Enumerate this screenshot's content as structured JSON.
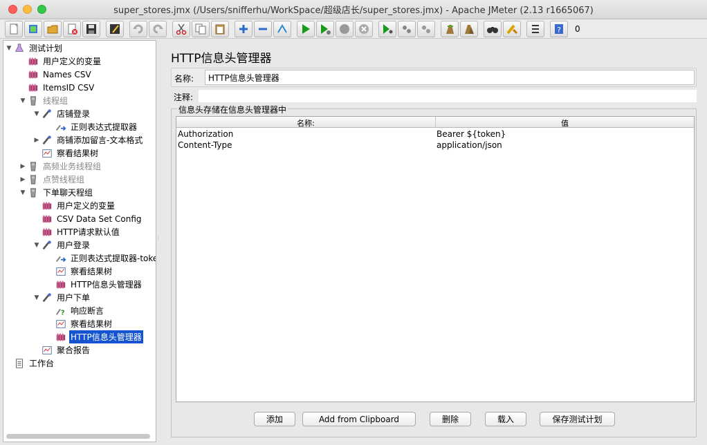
{
  "window": {
    "title": "super_stores.jmx (/Users/snifferhu/WorkSpace/超级店长/super_stores.jmx) - Apache JMeter (2.13 r1665067)"
  },
  "toolbar": {
    "buttons": [
      "new-icon",
      "templates-icon",
      "open-icon",
      "close-icon",
      "save-icon",
      "save-as-icon",
      "undo-icon",
      "redo-icon",
      "cut-icon",
      "copy-icon",
      "paste-icon",
      "expand-icon",
      "collapse-icon",
      "toggle-icon",
      "start-icon",
      "start-no-pause-icon",
      "stop-icon",
      "shutdown-icon",
      "remote-start-icon",
      "remote-stop-icon",
      "remote-shutdown-icon",
      "clear-icon",
      "clear-all-icon",
      "search-icon",
      "reset-search-icon",
      "function-helper-icon",
      "help-icon"
    ],
    "thread_count": "0"
  },
  "tree": {
    "items": [
      {
        "label": "测试计划",
        "icon": "test-plan-icon",
        "arrow": "▼"
      },
      {
        "label": "用户定义的变量",
        "icon": "config-icon",
        "arrow": ""
      },
      {
        "label": "Names CSV",
        "icon": "config-icon",
        "arrow": ""
      },
      {
        "label": "ItemsID CSV",
        "icon": "config-icon",
        "arrow": ""
      },
      {
        "label": "线程组",
        "icon": "thread-group-icon",
        "arrow": "▼"
      },
      {
        "label": "店铺登录",
        "icon": "sampler-icon",
        "arrow": "▼"
      },
      {
        "label": "正则表达式提取器",
        "icon": "extractor-icon",
        "arrow": ""
      },
      {
        "label": "商铺添加留言-文本格式",
        "icon": "sampler-icon",
        "arrow": "▶"
      },
      {
        "label": "察看结果树",
        "icon": "listener-icon",
        "arrow": ""
      },
      {
        "label": "高频业务线程组",
        "icon": "thread-group-icon",
        "arrow": "▶"
      },
      {
        "label": "点赞线程组",
        "icon": "thread-group-icon",
        "arrow": "▶"
      },
      {
        "label": "下单聊天程组",
        "icon": "thread-group-icon",
        "arrow": "▼"
      },
      {
        "label": "用户定义的变量",
        "icon": "config-icon",
        "arrow": ""
      },
      {
        "label": "CSV Data Set Config",
        "icon": "config-icon",
        "arrow": ""
      },
      {
        "label": "HTTP请求默认值",
        "icon": "config-icon",
        "arrow": ""
      },
      {
        "label": "用户登录",
        "icon": "sampler-icon",
        "arrow": "▼"
      },
      {
        "label": "正则表达式提取器-toke",
        "icon": "extractor-icon",
        "arrow": ""
      },
      {
        "label": "察看结果树",
        "icon": "listener-icon",
        "arrow": ""
      },
      {
        "label": "HTTP信息头管理器",
        "icon": "config-icon",
        "arrow": ""
      },
      {
        "label": "用户下单",
        "icon": "sampler-icon",
        "arrow": "▼"
      },
      {
        "label": "响应断言",
        "icon": "assertion-icon",
        "arrow": ""
      },
      {
        "label": "察看结果树",
        "icon": "listener-icon",
        "arrow": ""
      },
      {
        "label": "HTTP信息头管理器",
        "icon": "config-icon",
        "arrow": ""
      },
      {
        "label": "聚合报告",
        "icon": "listener-icon",
        "arrow": ""
      },
      {
        "label": "工作台",
        "icon": "workbench-icon",
        "arrow": ""
      }
    ]
  },
  "panel": {
    "title": "HTTP信息头管理器",
    "name_label": "名称:",
    "name_value": "HTTP信息头管理器",
    "comment_label": "注释:",
    "comment_value": "",
    "group_title": "信息头存储在信息头管理器中",
    "table": {
      "headers": [
        "名称:",
        "值"
      ],
      "rows": [
        [
          "Authorization",
          "Bearer ${token}"
        ],
        [
          "Content-Type",
          "application/json"
        ]
      ]
    },
    "buttons": {
      "add": "添加",
      "add_clipboard": "Add from Clipboard",
      "delete": "删除",
      "load": "载入",
      "save": "保存测试计划"
    }
  }
}
